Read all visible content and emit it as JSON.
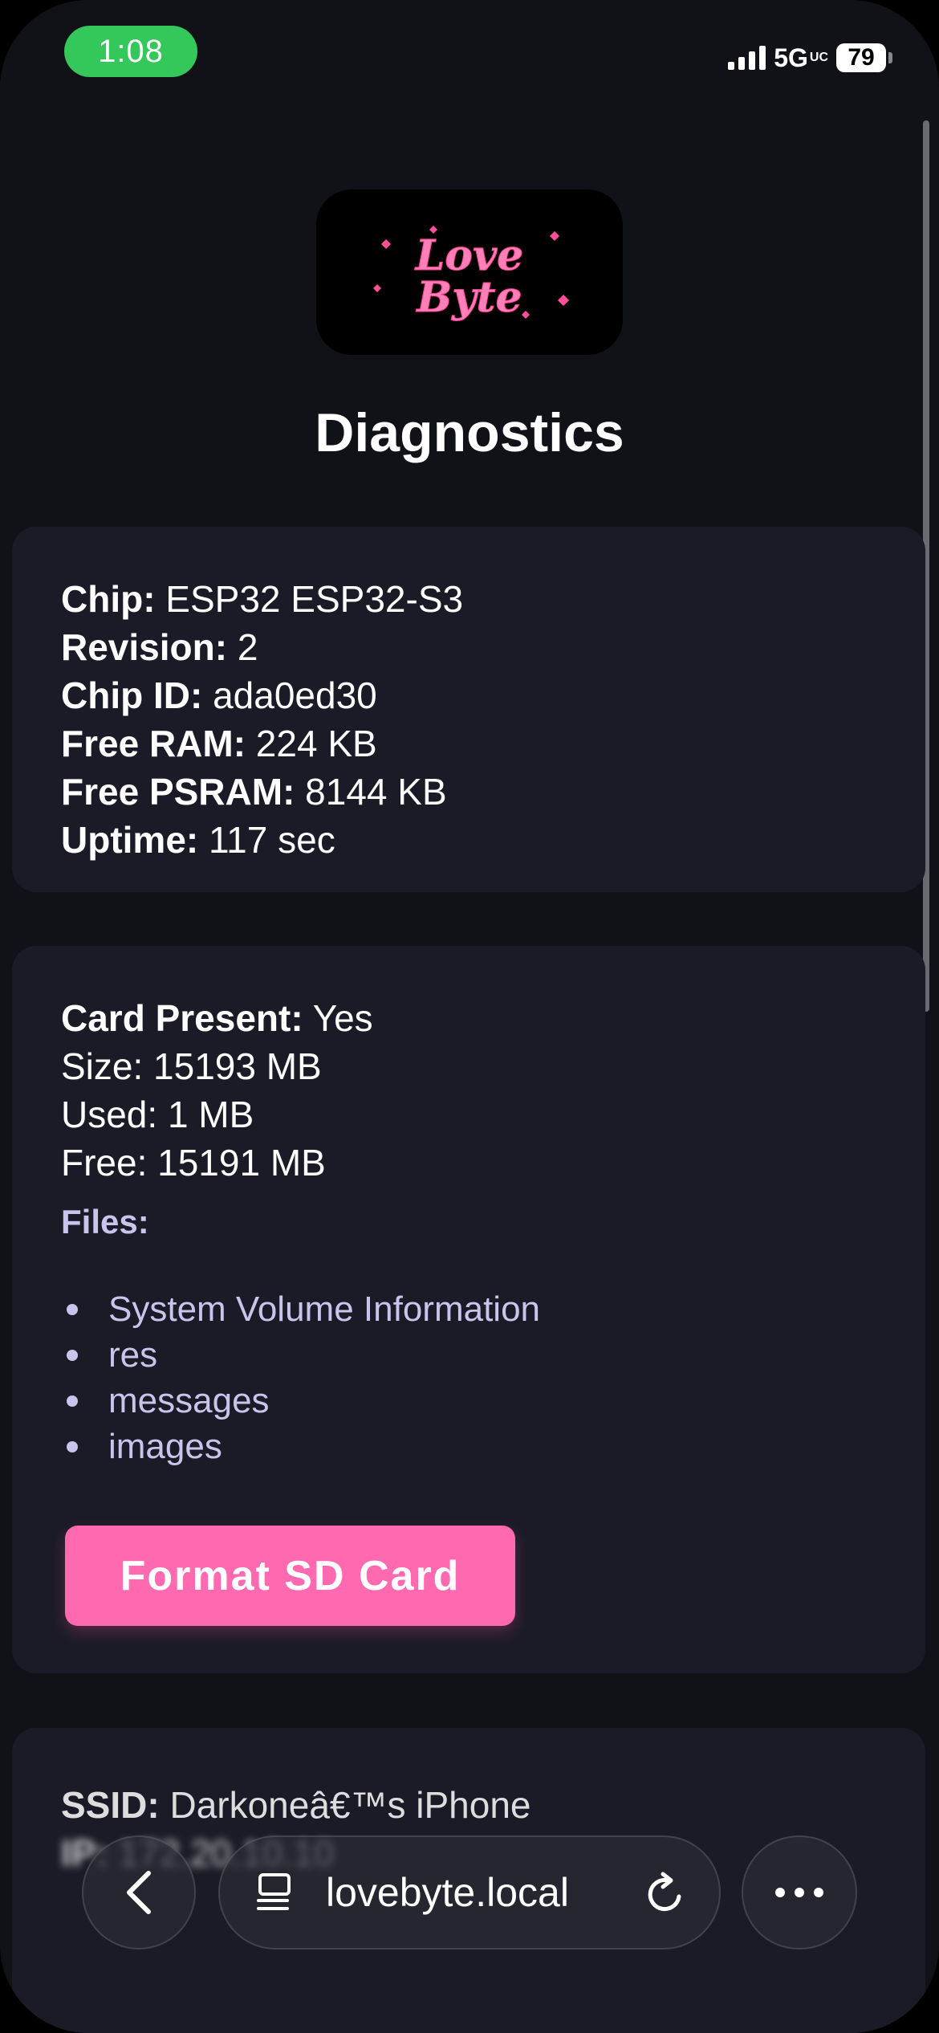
{
  "status_bar": {
    "time": "1:08",
    "network": "5G",
    "network_suffix": "UC",
    "battery": "79"
  },
  "header": {
    "logo_text_line1": "Love",
    "logo_text_line2": "Byte",
    "title": "Diagnostics"
  },
  "chip_card": {
    "rows": [
      {
        "label": "Chip:",
        "value": " ESP32 ESP32-S3"
      },
      {
        "label": "Revision:",
        "value": " 2"
      },
      {
        "label": "Chip ID:",
        "value": " ada0ed30"
      },
      {
        "label": "Free RAM:",
        "value": " 224 KB"
      },
      {
        "label": "Free PSRAM:",
        "value": " 8144 KB"
      },
      {
        "label": "Uptime:",
        "value": " 117 sec"
      }
    ]
  },
  "sd_card": {
    "present_label": "Card Present:",
    "present_value": " Yes",
    "size": "Size: 15193 MB",
    "used": "Used: 1 MB",
    "free": "Free: 15191 MB",
    "files_title": "Files:",
    "files": [
      "System Volume Information",
      "res",
      "messages",
      "images"
    ],
    "format_button": "Format SD Card"
  },
  "wifi_card": {
    "ssid_label": "SSID:",
    "ssid_value": " Darkoneâ€™s iPhone",
    "ip_label": "IP:",
    "ip_value": " 172.20.10.10"
  },
  "browser_bar": {
    "url": "lovebyte.local"
  },
  "colors": {
    "accent_pink": "#ff69b0",
    "card_bg": "#1b1b27",
    "page_bg": "#111118",
    "status_green": "#34c759"
  }
}
